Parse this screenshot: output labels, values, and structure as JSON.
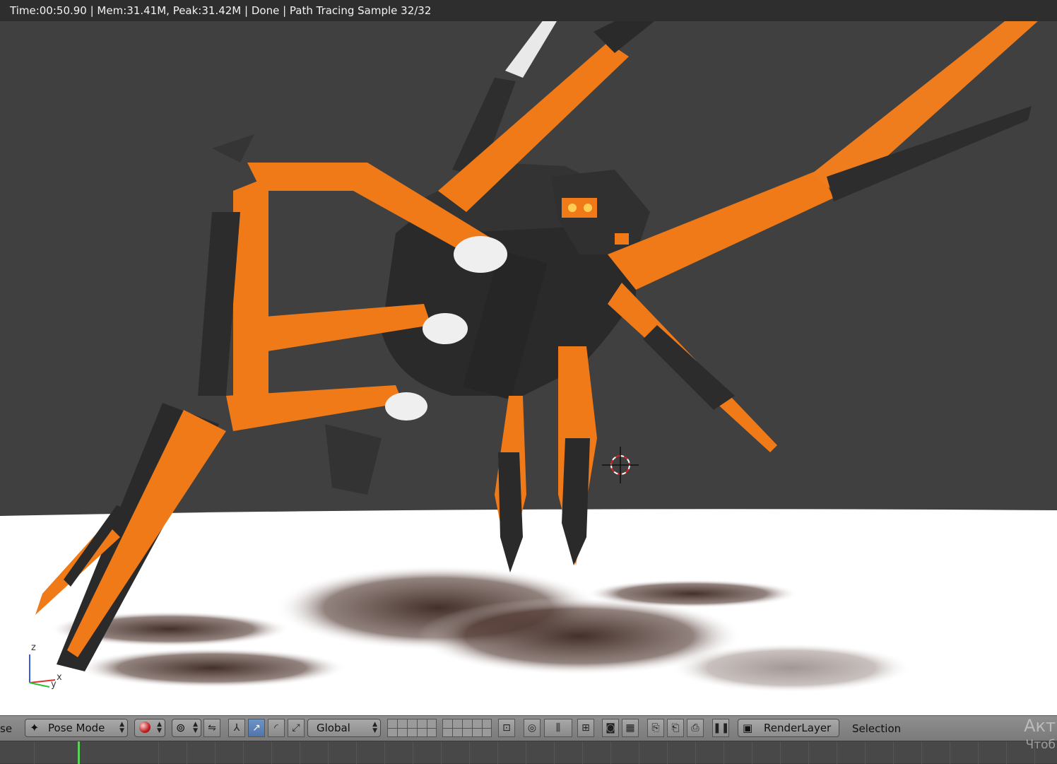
{
  "render_status": "Time:00:50.90 | Mem:31.41M, Peak:31.42M | Done | Path Tracing Sample 32/32",
  "axis_labels": {
    "z": "z",
    "x": "x",
    "y": "y"
  },
  "header": {
    "cut_label": "se",
    "mode_label": "Pose Mode",
    "orientation_label": "Global",
    "render_layer_label": "RenderLayer",
    "selection_label": "Selection"
  },
  "watermark": {
    "line1": "Акт",
    "line2": "Чтоб"
  },
  "colors": {
    "accent": "#f07a18",
    "viewport_bg": "#404040",
    "ground": "#ffffff",
    "header": "#858585"
  },
  "icons": [
    "mode-dropdown-icon",
    "viewport-shading-icon",
    "pivot-point-icon",
    "manipulator-icon",
    "translate-icon",
    "rotate-icon",
    "scale-icon",
    "layers-icon",
    "lock-icon",
    "proportional-edit-icon",
    "snap-icon",
    "render-icon",
    "copy-pose-icon",
    "paste-pose-icon",
    "paste-flipped-icon",
    "render-layer-icon"
  ]
}
